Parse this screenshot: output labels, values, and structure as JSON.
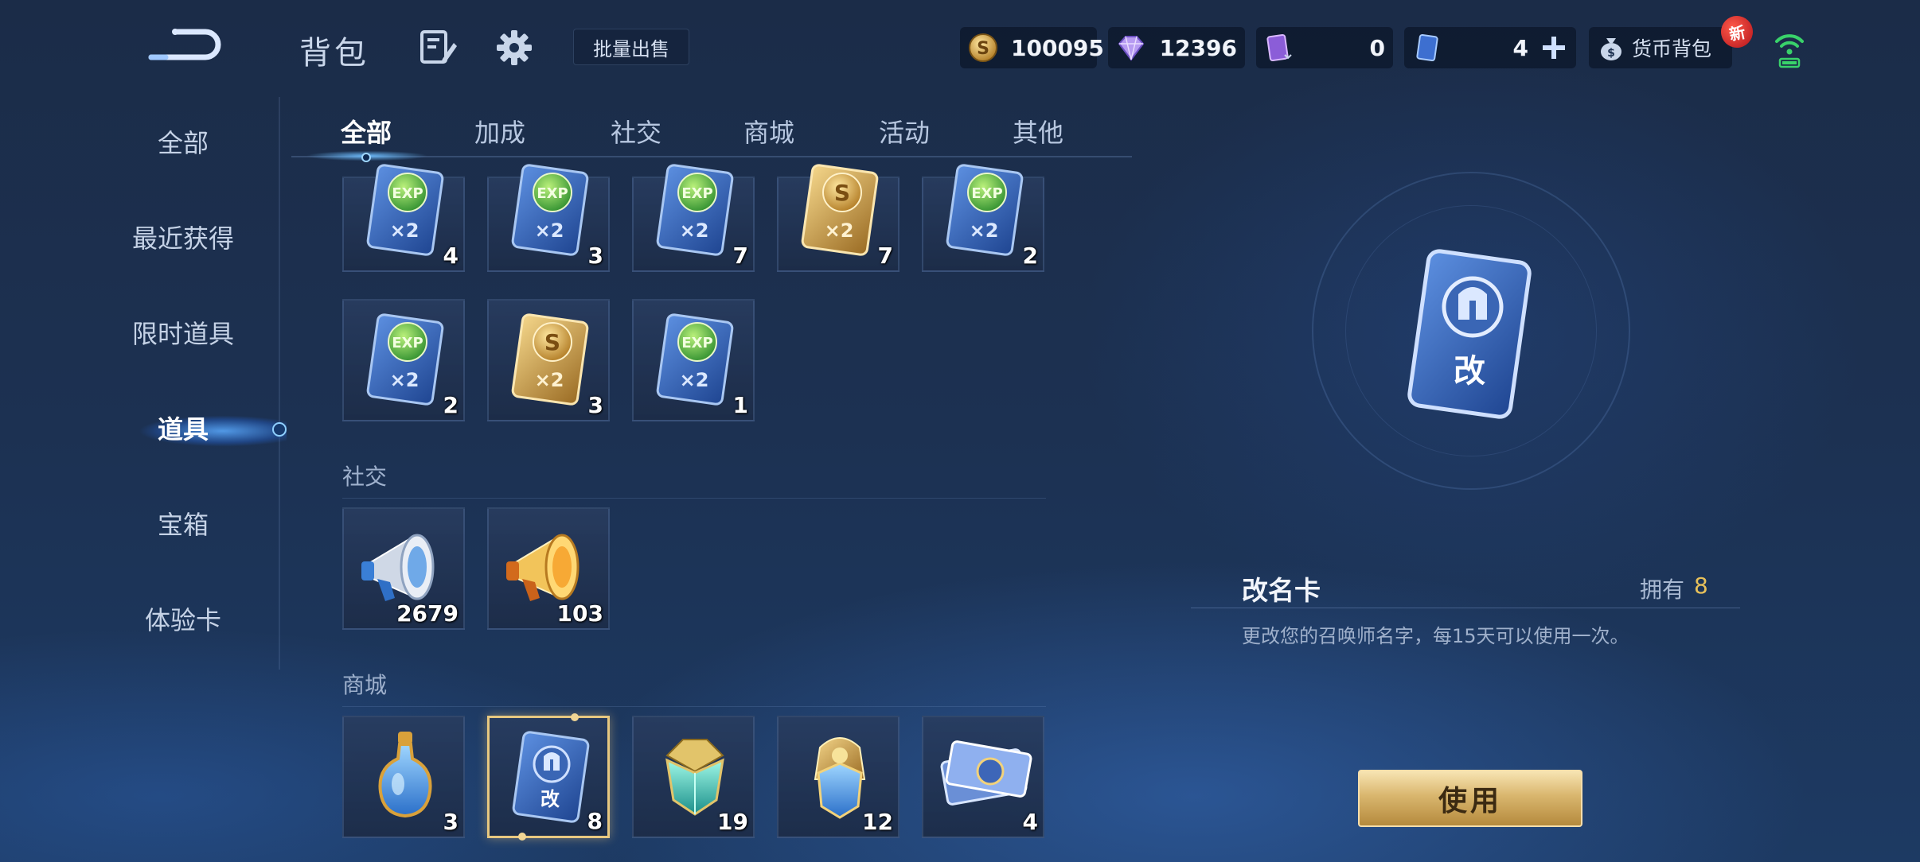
{
  "header": {
    "title": "背包",
    "bulk_sell_label": "批量出售",
    "currencies": {
      "gold": "100095",
      "diamond": "12396",
      "hero_card": "0",
      "skin_card": "4"
    },
    "wallet_label": "货币背包",
    "new_badge": "新"
  },
  "sidebar": {
    "items": [
      {
        "label": "全部"
      },
      {
        "label": "最近获得"
      },
      {
        "label": "限时道具"
      },
      {
        "label": "道具"
      },
      {
        "label": "宝箱"
      },
      {
        "label": "体验卡"
      }
    ],
    "active_index": 3
  },
  "tabs": [
    {
      "label": "全部"
    },
    {
      "label": "加成"
    },
    {
      "label": "社交"
    },
    {
      "label": "商城"
    },
    {
      "label": "活动"
    },
    {
      "label": "其他"
    }
  ],
  "sections": {
    "social": {
      "title": "社交"
    },
    "store": {
      "title": "商城"
    }
  },
  "items": {
    "r1": [
      {
        "icon": "exp-double-card-icon",
        "count": "4"
      },
      {
        "icon": "exp-double-card-icon",
        "count": "3"
      },
      {
        "icon": "exp-double-card-icon",
        "count": "7"
      },
      {
        "icon": "gold-double-card-icon",
        "count": "7"
      },
      {
        "icon": "exp-double-card-icon",
        "count": "2"
      }
    ],
    "r2": [
      {
        "icon": "exp-double-card-icon",
        "count": "2"
      },
      {
        "icon": "gold-double-card-icon",
        "count": "3"
      },
      {
        "icon": "exp-double-card-icon",
        "count": "1"
      }
    ],
    "social": [
      {
        "icon": "silver-megaphone-icon",
        "count": "2679"
      },
      {
        "icon": "gold-megaphone-icon",
        "count": "103"
      }
    ],
    "store": [
      {
        "icon": "blue-potion-icon",
        "count": "3"
      },
      {
        "icon": "rename-card-icon",
        "count": "8"
      },
      {
        "icon": "teal-crystal-icon",
        "count": "19"
      },
      {
        "icon": "gold-crystal-icon",
        "count": "12"
      },
      {
        "icon": "ticket-icon",
        "count": "4"
      }
    ]
  },
  "detail": {
    "name": "改名卡",
    "own_label": "拥有",
    "own_count": "8",
    "description": "更改您的召唤师名字，每15天可以使用一次。",
    "card_glyph": "改",
    "use_label": "使用"
  },
  "card_text": {
    "exp": "EXP",
    "gold": "S",
    "multiplier": "×2"
  },
  "colors": {
    "accent_gold": "#e8c15a",
    "selection": "#e7c880",
    "card_blue": "#2f5fb0"
  }
}
